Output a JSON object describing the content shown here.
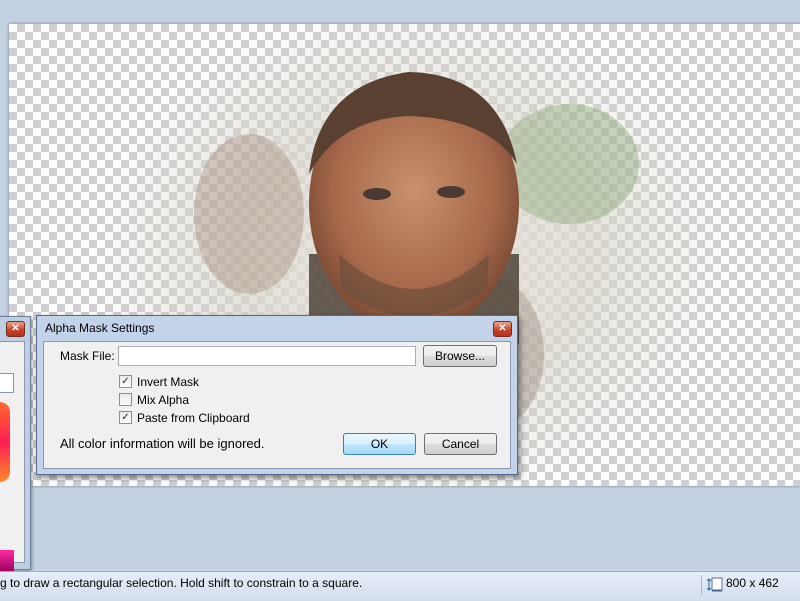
{
  "dialog": {
    "title": "Alpha Mask Settings",
    "close_glyph": "✕",
    "mask_file_label": "Mask File:",
    "mask_file_value": "",
    "browse_label": "Browse...",
    "options": [
      {
        "label": "Invert Mask",
        "checked": true
      },
      {
        "label": "Mix Alpha",
        "checked": false
      },
      {
        "label": "Paste from Clipboard",
        "checked": true
      }
    ],
    "info_text": "All color information will be ignored.",
    "ok_label": "OK",
    "cancel_label": "Cancel"
  },
  "colors_window": {
    "close_glyph": "✕"
  },
  "statusbar": {
    "hint": "g to draw a rectangular selection. Hold shift to constrain to a square.",
    "image_size": "800 x 462"
  },
  "colors": {
    "accent_close": "#c8452c",
    "dialog_frame": "#c2d3ea",
    "workspace": "#c4d1e2"
  },
  "icons": {
    "size": "image-size-icon",
    "close": "close-icon",
    "check": "checkmark-icon"
  }
}
